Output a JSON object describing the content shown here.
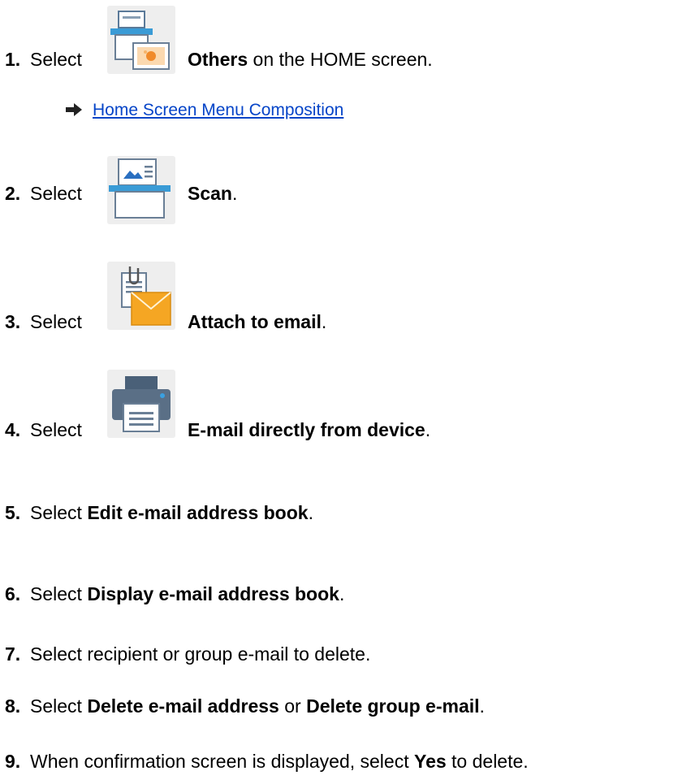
{
  "steps": [
    {
      "num": "1.",
      "pre": "Select",
      "icon": "others-icon",
      "bold": "Others",
      "post": " on the HOME screen."
    },
    {
      "num": "2.",
      "pre": "Select",
      "icon": "scan-icon",
      "bold": "Scan",
      "post": "."
    },
    {
      "num": "3.",
      "pre": "Select",
      "icon": "attach-to-email-icon",
      "bold": "Attach to email",
      "post": "."
    },
    {
      "num": "4.",
      "pre": "Select",
      "icon": "printer-icon",
      "bold": "E-mail directly from device",
      "post": "."
    },
    {
      "num": "5.",
      "pre": "Select ",
      "bold": "Edit e-mail address book",
      "post": "."
    },
    {
      "num": "6.",
      "pre": "Select ",
      "bold": "Display e-mail address book",
      "post": "."
    },
    {
      "num": "7.",
      "text": "Select recipient or group e-mail to delete."
    },
    {
      "num": "8.",
      "pre": "Select ",
      "bold": "Delete e-mail address",
      "mid": " or ",
      "bold2": "Delete group e-mail",
      "post": "."
    },
    {
      "num": "9.",
      "pre": "When confirmation screen is displayed, select ",
      "bold": "Yes",
      "post": " to delete."
    }
  ],
  "link": {
    "icon": "right-arrow-icon",
    "label": "Home Screen Menu Composition"
  },
  "colors": {
    "link": "#0645c8",
    "icon_bg": "#eeeeee",
    "scanner_blue": "#3a9bd6",
    "envelope": "#f5a623"
  }
}
